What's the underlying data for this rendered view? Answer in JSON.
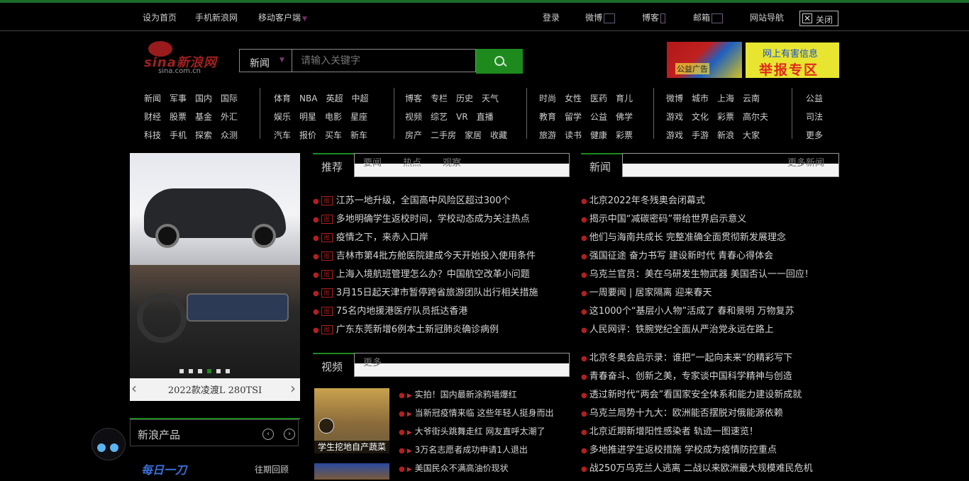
{
  "topbar": {
    "left_links": [
      {
        "label": "设为首页"
      },
      {
        "label": "手机新浪网"
      },
      {
        "label": "移动客户端"
      }
    ],
    "right_links": [
      {
        "label": "登录"
      },
      {
        "label": "微博"
      },
      {
        "label": "博客"
      },
      {
        "label": "邮箱"
      },
      {
        "label": "网站导航"
      }
    ],
    "close_label": "关闭"
  },
  "logo": {
    "wordmark": "sina新浪网",
    "domain": "sina.com.cn"
  },
  "search": {
    "category": "新闻",
    "placeholder": "请输入关键字"
  },
  "ads": {
    "ad1_text": "公益广告",
    "ad2_line1": "网上有害信息",
    "ad2_line2": "举报专区"
  },
  "nav": {
    "groups": [
      [
        [
          "新闻",
          "军事",
          "国内",
          "国际"
        ],
        [
          "财经",
          "股票",
          "基金",
          "外汇"
        ],
        [
          "科技",
          "手机",
          "探索",
          "众测"
        ]
      ],
      [
        [
          "体育",
          "NBA",
          "英超",
          "中超"
        ],
        [
          "娱乐",
          "明星",
          "电影",
          "星座"
        ],
        [
          "汽车",
          "报价",
          "买车",
          "新车"
        ]
      ],
      [
        [
          "博客",
          "专栏",
          "历史",
          "天气"
        ],
        [
          "视频",
          "综艺",
          "VR",
          "直播"
        ],
        [
          "房产",
          "二手房",
          "家居",
          "收藏"
        ]
      ],
      [
        [
          "时尚",
          "女性",
          "医药",
          "育儿"
        ],
        [
          "教育",
          "留学",
          "公益",
          "佛学"
        ],
        [
          "旅游",
          "读书",
          "健康",
          "彩票"
        ]
      ],
      [
        [
          "微博",
          "城市",
          "上海",
          "云南"
        ],
        [
          "游戏",
          "文化",
          "彩票",
          "高尔夫"
        ],
        [
          "游戏",
          "手游",
          "新浪",
          "大家"
        ]
      ],
      [
        [
          "公益"
        ],
        [
          "司法"
        ],
        [
          "更多"
        ]
      ]
    ]
  },
  "carousel": {
    "caption": "2022款凌渡L 280TSI"
  },
  "products": {
    "title": "新浪产品",
    "daily": "每日一刀",
    "past": "往期回顾"
  },
  "hot": {
    "label": "推荐",
    "tabs": [
      "要闻",
      "热点",
      "观察"
    ],
    "items": [
      "江苏一地升级，全国高中风险区超过300个",
      "多地明确学生返校时间，学校动态成为关注热点",
      "疫情之下，来赤入口岸",
      "吉林市第4批方舱医院建成今天开始投入使用条件",
      "上海入境航班管理怎么办？中国航空改革小问题",
      "3月15日起天津市暂停跨省旅游团队出行相关措施",
      "75名内地援港医疗队员抵达香港",
      "广东东莞新增6例本土新冠肺炎确诊病例"
    ]
  },
  "news": {
    "label": "新闻",
    "more": "更多新闻",
    "items": [
      "北京2022年冬残奥会闭幕式",
      "揭示中国“减碳密码”带给世界启示意义",
      "他们与海南共成长 完整准确全面贯彻新发展理念",
      "强国征途 奋力书写 建设新时代 青春心得体会",
      "乌克兰官员：美在乌研发生物武器 美国否认一一回应！",
      "一周要闻 | 居家隔离 迎来春天",
      "这1000个“基层小人物”活成了 春和景明 万物复苏",
      "人民网评：铁腕党纪全面从严治党永远在路上"
    ],
    "items2": [
      "北京冬奥会启示录：谁把“一起向未来”的精彩写下",
      "青春奋斗、创新之美，专家谈中国科学精神与创造",
      "透过新时代“两会”看国家安全体系和能力建设新成就",
      "乌克兰局势十九大：欧洲能否摆脱对俄能源依赖",
      "北京近期新增阳性感染者 轨迹一图速览！",
      "多地推进学生返校措施 学校成为疫情防控重点",
      "战250万乌克兰人逃离 二战以来欧洲最大规模难民危机"
    ]
  },
  "video": {
    "label": "视频",
    "tabs": [
      "更多"
    ],
    "thumb_caption": "学生挖地自产蔬菜",
    "items": [
      "实拍！国内最新涂鸦墙爆红",
      "当新冠疫情来临 这些年轻人挺身而出",
      "大爷街头跳舞走红 网友直呼太潮了",
      "3万名志愿者成功申请1人退出",
      "美国民众不满高油价现状"
    ]
  }
}
